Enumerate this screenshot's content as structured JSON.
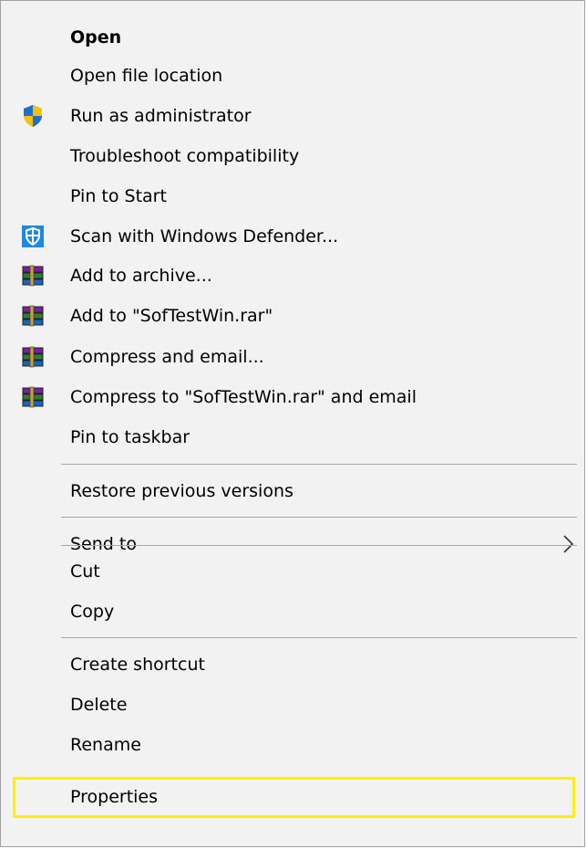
{
  "menu": {
    "items": [
      {
        "label": "Open",
        "icon": null
      },
      {
        "label": "Open file location",
        "icon": null
      },
      {
        "label": "Run as administrator",
        "icon": "uac-shield-icon"
      },
      {
        "label": "Troubleshoot compatibility",
        "icon": null
      },
      {
        "label": "Pin to Start",
        "icon": null
      },
      {
        "label": "Scan with Windows Defender...",
        "icon": "windows-defender-icon"
      },
      {
        "label": "Add to archive...",
        "icon": "winrar-archive-icon"
      },
      {
        "label": "Add to \"SofTestWin.rar\"",
        "icon": "winrar-archive-icon"
      },
      {
        "label": "Compress and email...",
        "icon": "winrar-archive-icon"
      },
      {
        "label": "Compress to \"SofTestWin.rar\" and email",
        "icon": "winrar-archive-icon"
      },
      {
        "label": "Pin to taskbar",
        "icon": null
      },
      {
        "label": "Restore previous versions",
        "icon": null
      },
      {
        "label": "Send to",
        "icon": "chevron-right-icon"
      },
      {
        "label": "Cut",
        "icon": null
      },
      {
        "label": "Copy",
        "icon": null
      },
      {
        "label": "Create shortcut",
        "icon": null
      },
      {
        "label": "Delete",
        "icon": null
      },
      {
        "label": "Rename",
        "icon": null
      },
      {
        "label": "Properties",
        "icon": null
      }
    ],
    "highlighted_item": "Properties",
    "colors": {
      "background": "#f2f2f2",
      "separator": "#a8a8a8",
      "highlight_border": "#ffee00",
      "shield_blue": "#1f6fd1",
      "shield_yellow": "#f4c20d",
      "defender_blue": "#1e88e5"
    }
  }
}
